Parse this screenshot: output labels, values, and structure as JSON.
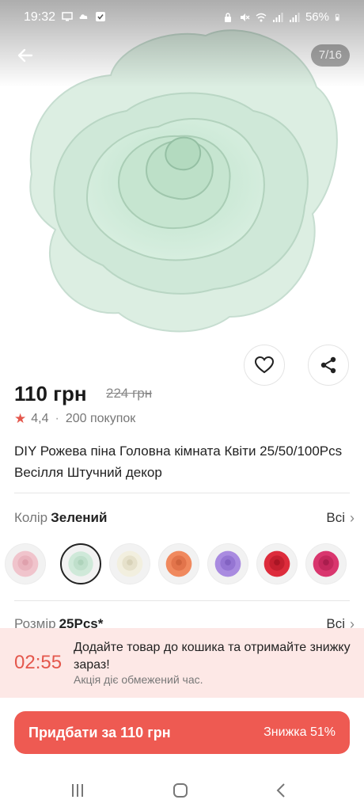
{
  "status_bar": {
    "time": "19:32",
    "battery": "56%",
    "icons_left": [
      "screen-icon",
      "cloud-icon",
      "check-icon"
    ],
    "icons_right": [
      "lock-icon",
      "mute-icon",
      "wifi-icon",
      "signal-icon",
      "signal-icon",
      "battery-icon"
    ]
  },
  "gallery": {
    "counter": "7/16",
    "image": "mint-green-foam-rose"
  },
  "product": {
    "price": "110 грн",
    "old_price": "224 грн",
    "rating": "4,4",
    "purchases": "200 покупок",
    "title": "DIY Рожева піна Головна кімната Квіти 25/50/100Pcs Весілля Штучний декор"
  },
  "color_option": {
    "label": "Колір",
    "value": "Зелений",
    "all": "Всі",
    "swatches": [
      {
        "name": "pink",
        "color": "#f0c4cc"
      },
      {
        "name": "green",
        "color": "#cfe9d9",
        "selected": true
      },
      {
        "name": "ivory",
        "color": "#f2efdf"
      },
      {
        "name": "orange",
        "color": "#f0895e"
      },
      {
        "name": "lavender",
        "color": "#a98be0"
      },
      {
        "name": "red",
        "color": "#dd2c3c"
      },
      {
        "name": "rose",
        "color": "#d9366e"
      }
    ]
  },
  "size_option": {
    "label": "Розмір",
    "value": "25Pcs*",
    "all": "Всі"
  },
  "promo": {
    "timer": "02:55",
    "text": "Додайте товар до кошика та отримайте знижку зараз!",
    "subtext": "Акція діє обмежений час."
  },
  "buy_button": {
    "label": "Придбати за 110 грн",
    "discount": "Знижка 51%"
  },
  "colors": {
    "accent": "#ee5a52",
    "accent_text": "#e4574c",
    "promo_bg": "#fde8e6"
  }
}
